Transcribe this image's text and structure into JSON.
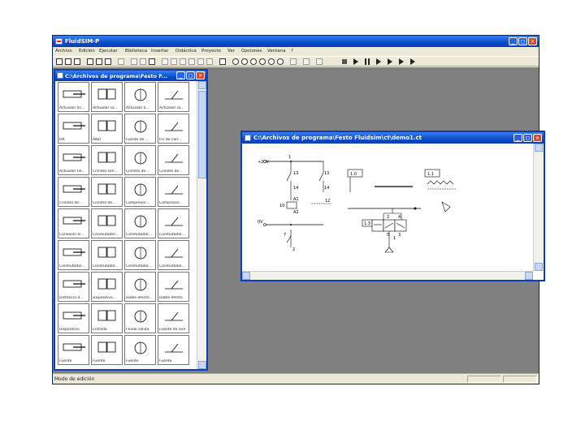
{
  "app": {
    "title": "FluidSIM-P"
  },
  "window_buttons": {
    "minimize": "_",
    "maximize": "□",
    "close": "✕"
  },
  "menu": [
    "Archivo",
    "Edición",
    "Ejecutar",
    "Biblioteca",
    "Insertar",
    "Didáctica",
    "Proyecto",
    "Ver",
    "Opciones",
    "Ventana",
    "?"
  ],
  "library": {
    "title": "C:\\Archivos de programa\\Festo F...",
    "items": [
      "Actuador lin...",
      "Actuador ro...",
      "Actuador li...",
      "Actuador ro...",
      "OR",
      "AND",
      "Fuente de ...",
      "Fin de carr...",
      "Actuador tie...",
      "Cilindro sim...",
      "Cilindro de...",
      "Cilindro de...",
      "Cilindro de...",
      "Cilindro de...",
      "Compresor...",
      "Compresor...",
      "Conexión el...",
      "Conmutador...",
      "Conmutador...",
      "Conmutador...",
      "Conmutador...",
      "Conmutador...",
      "Conmutador...",
      "Conmutador...",
      "Distancia d...",
      "Dispositivo...",
      "Doble efecto...",
      "Doble efecto",
      "Dispositivo",
      "Entrada",
      "Fluido salida",
      "Fuente de aire",
      "Fuente",
      "Fuente",
      "Fuente",
      "Fuente"
    ],
    "labels": {
      "p24v": "+24V",
      "p0v": "0V",
      "i": "I"
    }
  },
  "circuit": {
    "title": "C:\\Archivos de programa\\Festo Fluidsim\\ct\\demo1.ct",
    "labels": {
      "v24": "+24V",
      "n1": "1",
      "n13a": "13",
      "n13b": "13",
      "n14a": "14",
      "n14b": "14",
      "a1": "A1",
      "n10": "10",
      "n12": "12",
      "a2": "A2",
      "v0": "0V",
      "n7": "7",
      "n2": "2",
      "ctr1": "1.0",
      "ctr2": "1.1",
      "ctr3": "1.2",
      "yv": "1.3",
      "p2": "2",
      "p4": "4",
      "p5": "5",
      "p3": "3",
      "p1": "1"
    }
  },
  "status": {
    "text": "Modo de edición"
  }
}
